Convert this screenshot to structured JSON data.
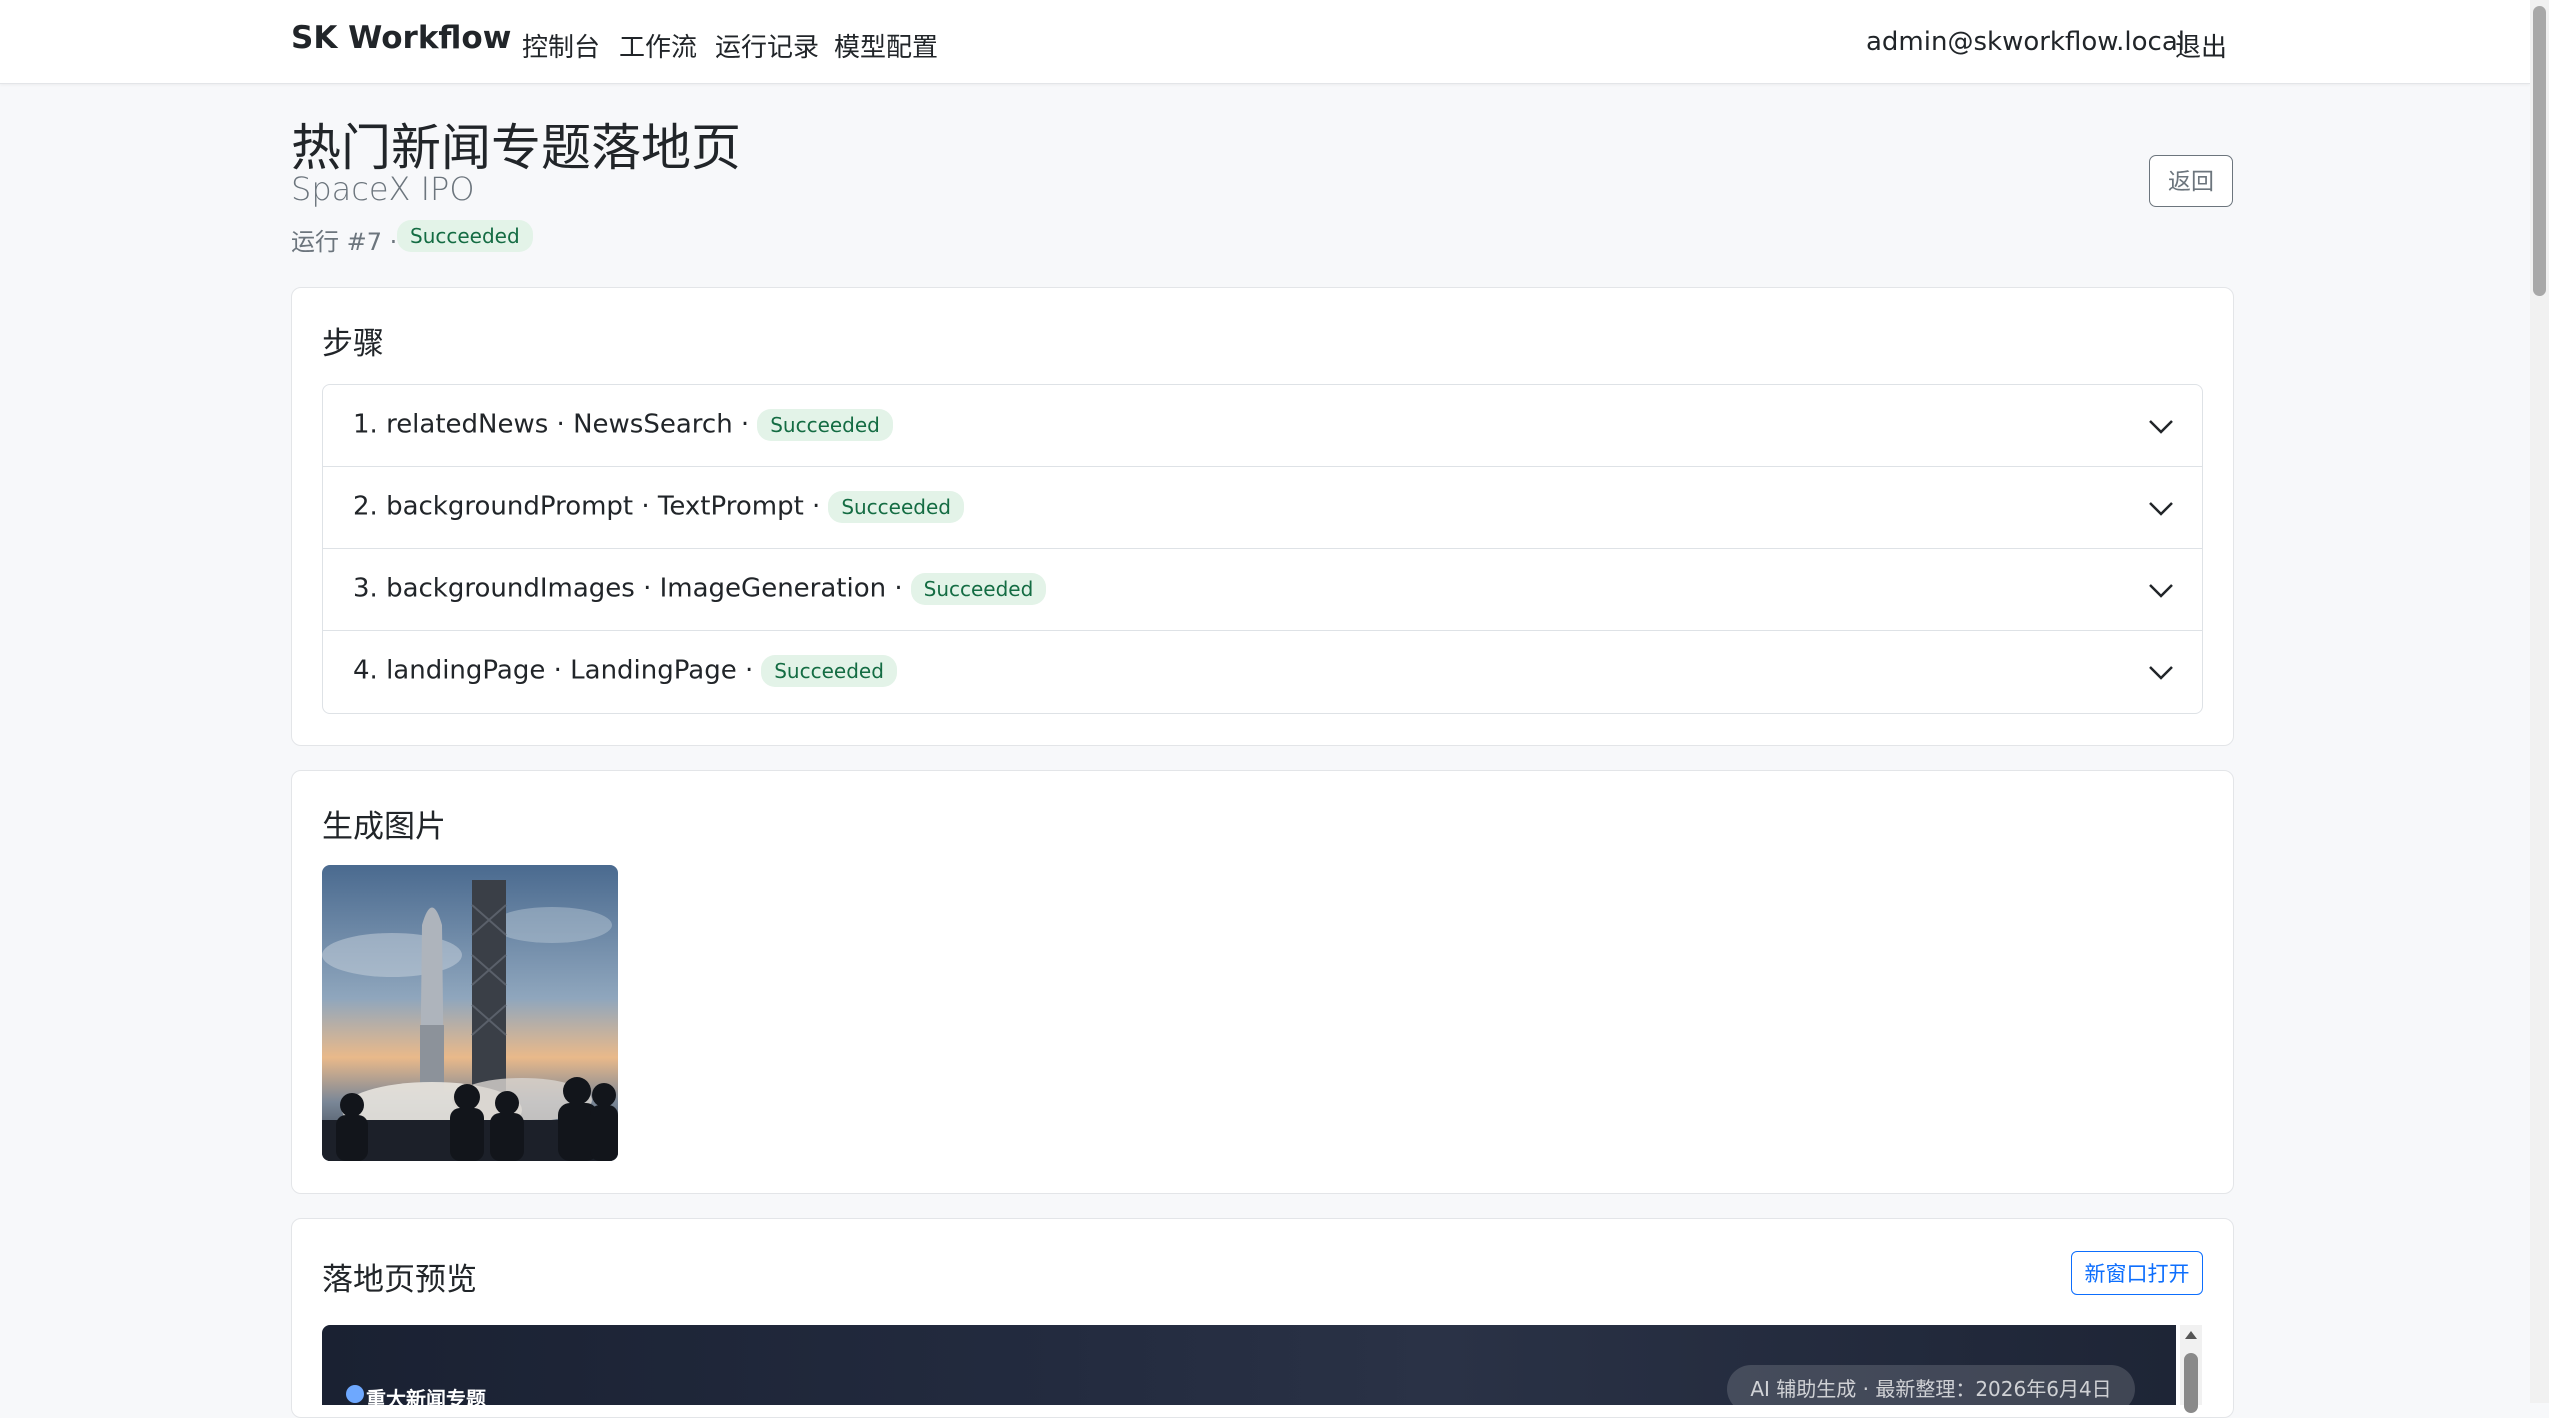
{
  "nav": {
    "brand": "SK Workflow",
    "links": [
      "控制台",
      "工作流",
      "运行记录",
      "模型配置"
    ],
    "user": "admin@skworkflow.local",
    "logout": "退出"
  },
  "header": {
    "title": "热门新闻专题落地页",
    "subtitle": "SpaceX IPO",
    "run_label": "运行 #7 ·",
    "run_status": "Succeeded",
    "back": "返回"
  },
  "steps": {
    "title": "步骤",
    "items": [
      {
        "label": "1. relatedNews · NewsSearch ·",
        "status": "Succeeded"
      },
      {
        "label": "2. backgroundPrompt · TextPrompt ·",
        "status": "Succeeded"
      },
      {
        "label": "3. backgroundImages · ImageGeneration ·",
        "status": "Succeeded"
      },
      {
        "label": "4. landingPage · LandingPage ·",
        "status": "Succeeded"
      }
    ]
  },
  "images": {
    "title": "生成图片"
  },
  "preview": {
    "title": "落地页预览",
    "open_new_window": "新窗口打开",
    "topic": "重大新闻专题",
    "pill": "AI 辅助生成 · 最新整理：2026年6月4日"
  },
  "colors": {
    "success_bg": "#e3f3e8",
    "success_text": "#146c43",
    "primary": "#0d6efd"
  }
}
